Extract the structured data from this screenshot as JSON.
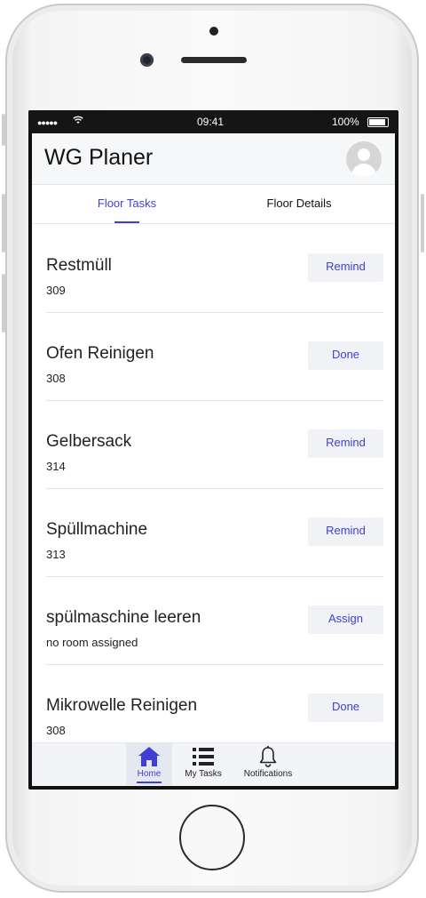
{
  "status_bar": {
    "signal": "●●●●●",
    "time": "09:41",
    "battery": "100%"
  },
  "app": {
    "title": "WG Planer"
  },
  "tabs": [
    {
      "label": "Floor Tasks",
      "active": true
    },
    {
      "label": "Floor Details",
      "active": false
    }
  ],
  "tasks": [
    {
      "title": "Restmüll",
      "room": "309",
      "action": "Remind"
    },
    {
      "title": "Ofen Reinigen",
      "room": "308",
      "action": "Done"
    },
    {
      "title": "Gelbersack",
      "room": "314",
      "action": "Remind"
    },
    {
      "title": "Spüllmachine",
      "room": "313",
      "action": "Remind"
    },
    {
      "title": "spülmaschine leeren",
      "room": "no room assigned",
      "action": "Assign"
    },
    {
      "title": "Mikrowelle Reinigen",
      "room": "308",
      "action": "Done"
    }
  ],
  "bottom_nav": [
    {
      "label": "Home",
      "icon": "home-icon",
      "active": true
    },
    {
      "label": "My Tasks",
      "icon": "list-icon",
      "active": false
    },
    {
      "label": "Notifications",
      "icon": "bell-icon",
      "active": false
    }
  ],
  "colors": {
    "accent": "#3f3fd6",
    "button_bg": "#f1f2f5",
    "divider": "#e3e5ea"
  }
}
